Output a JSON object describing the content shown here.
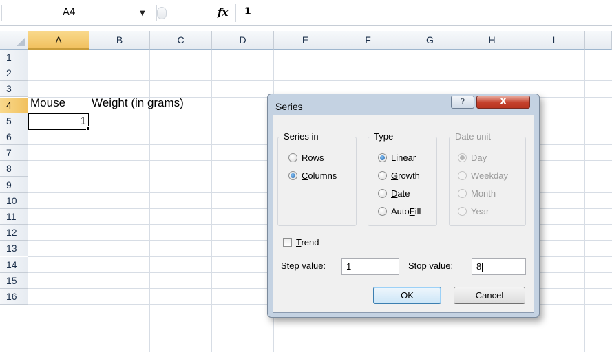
{
  "formula_bar": {
    "name_box": "A4",
    "fx_label": "fx",
    "formula_value": "1"
  },
  "columns": [
    "A",
    "B",
    "C",
    "D",
    "E",
    "F",
    "G",
    "H",
    "I"
  ],
  "rows": [
    "1",
    "2",
    "3",
    "4",
    "5",
    "6",
    "7",
    "8",
    "9",
    "10",
    "11",
    "12",
    "13",
    "14",
    "15",
    "16"
  ],
  "cells": {
    "A3": "Mouse",
    "B3": "Weight (in grams)",
    "A4": "1"
  },
  "selection": {
    "column": "A",
    "row": "4"
  },
  "dialog": {
    "title": "Series",
    "help_label": "?",
    "close_label": "X",
    "series_in": {
      "label": "Series in",
      "options": [
        {
          "pre": "",
          "key": "R",
          "post": "ows",
          "selected": false
        },
        {
          "pre": "",
          "key": "C",
          "post": "olumns",
          "selected": true
        }
      ]
    },
    "type": {
      "label": "Type",
      "options": [
        {
          "pre": "",
          "key": "L",
          "post": "inear",
          "selected": true
        },
        {
          "pre": "",
          "key": "G",
          "post": "rowth",
          "selected": false
        },
        {
          "pre": "",
          "key": "D",
          "post": "ate",
          "selected": false
        },
        {
          "pre": "Auto",
          "key": "F",
          "post": "ill",
          "selected": false
        }
      ]
    },
    "date_unit": {
      "label": "Date unit",
      "disabled": true,
      "options": [
        {
          "label": "Day",
          "selected": true
        },
        {
          "label": "Weekday",
          "selected": false
        },
        {
          "label": "Month",
          "selected": false
        },
        {
          "label": "Year",
          "selected": false
        }
      ]
    },
    "trend": {
      "key": "T",
      "post": "rend",
      "checked": false
    },
    "step": {
      "key": "S",
      "post": "tep value:",
      "value": "1"
    },
    "stop": {
      "pre": "St",
      "key": "o",
      "post": "p value:",
      "value": "8"
    },
    "ok_label": "OK",
    "cancel_label": "Cancel"
  }
}
